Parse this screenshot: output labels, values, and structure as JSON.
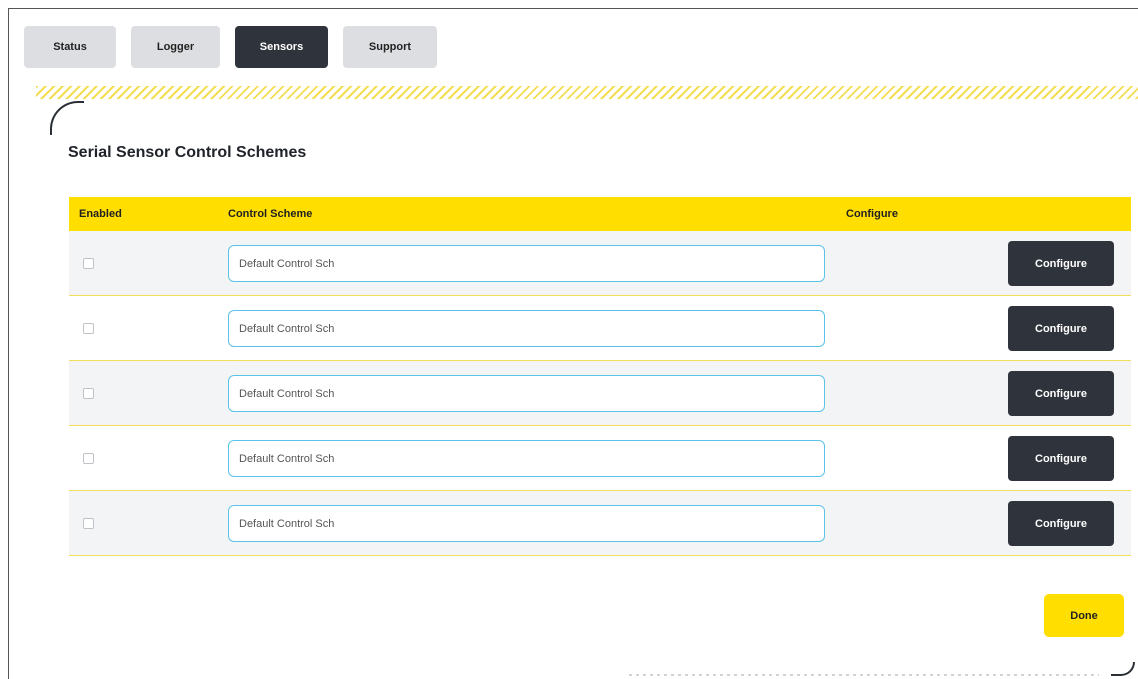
{
  "tabs": [
    {
      "label": "Status",
      "active": false
    },
    {
      "label": "Logger",
      "active": false
    },
    {
      "label": "Sensors",
      "active": true
    },
    {
      "label": "Support",
      "active": false
    }
  ],
  "page": {
    "title": "Serial Sensor Control Schemes"
  },
  "table": {
    "headers": {
      "enabled": "Enabled",
      "control_scheme": "Control Scheme",
      "configure": "Configure"
    },
    "rows": [
      {
        "enabled": false,
        "scheme_value": "Default Control Sch",
        "button_label": "Configure"
      },
      {
        "enabled": false,
        "scheme_value": "Default Control Sch",
        "button_label": "Configure"
      },
      {
        "enabled": false,
        "scheme_value": "Default Control Sch",
        "button_label": "Configure"
      },
      {
        "enabled": false,
        "scheme_value": "Default Control Sch",
        "button_label": "Configure"
      },
      {
        "enabled": false,
        "scheme_value": "Default Control Sch",
        "button_label": "Configure"
      }
    ]
  },
  "actions": {
    "done_label": "Done"
  },
  "colors": {
    "accent": "#ffde00",
    "dark": "#2f343c",
    "input_border": "#5cc3e8"
  }
}
